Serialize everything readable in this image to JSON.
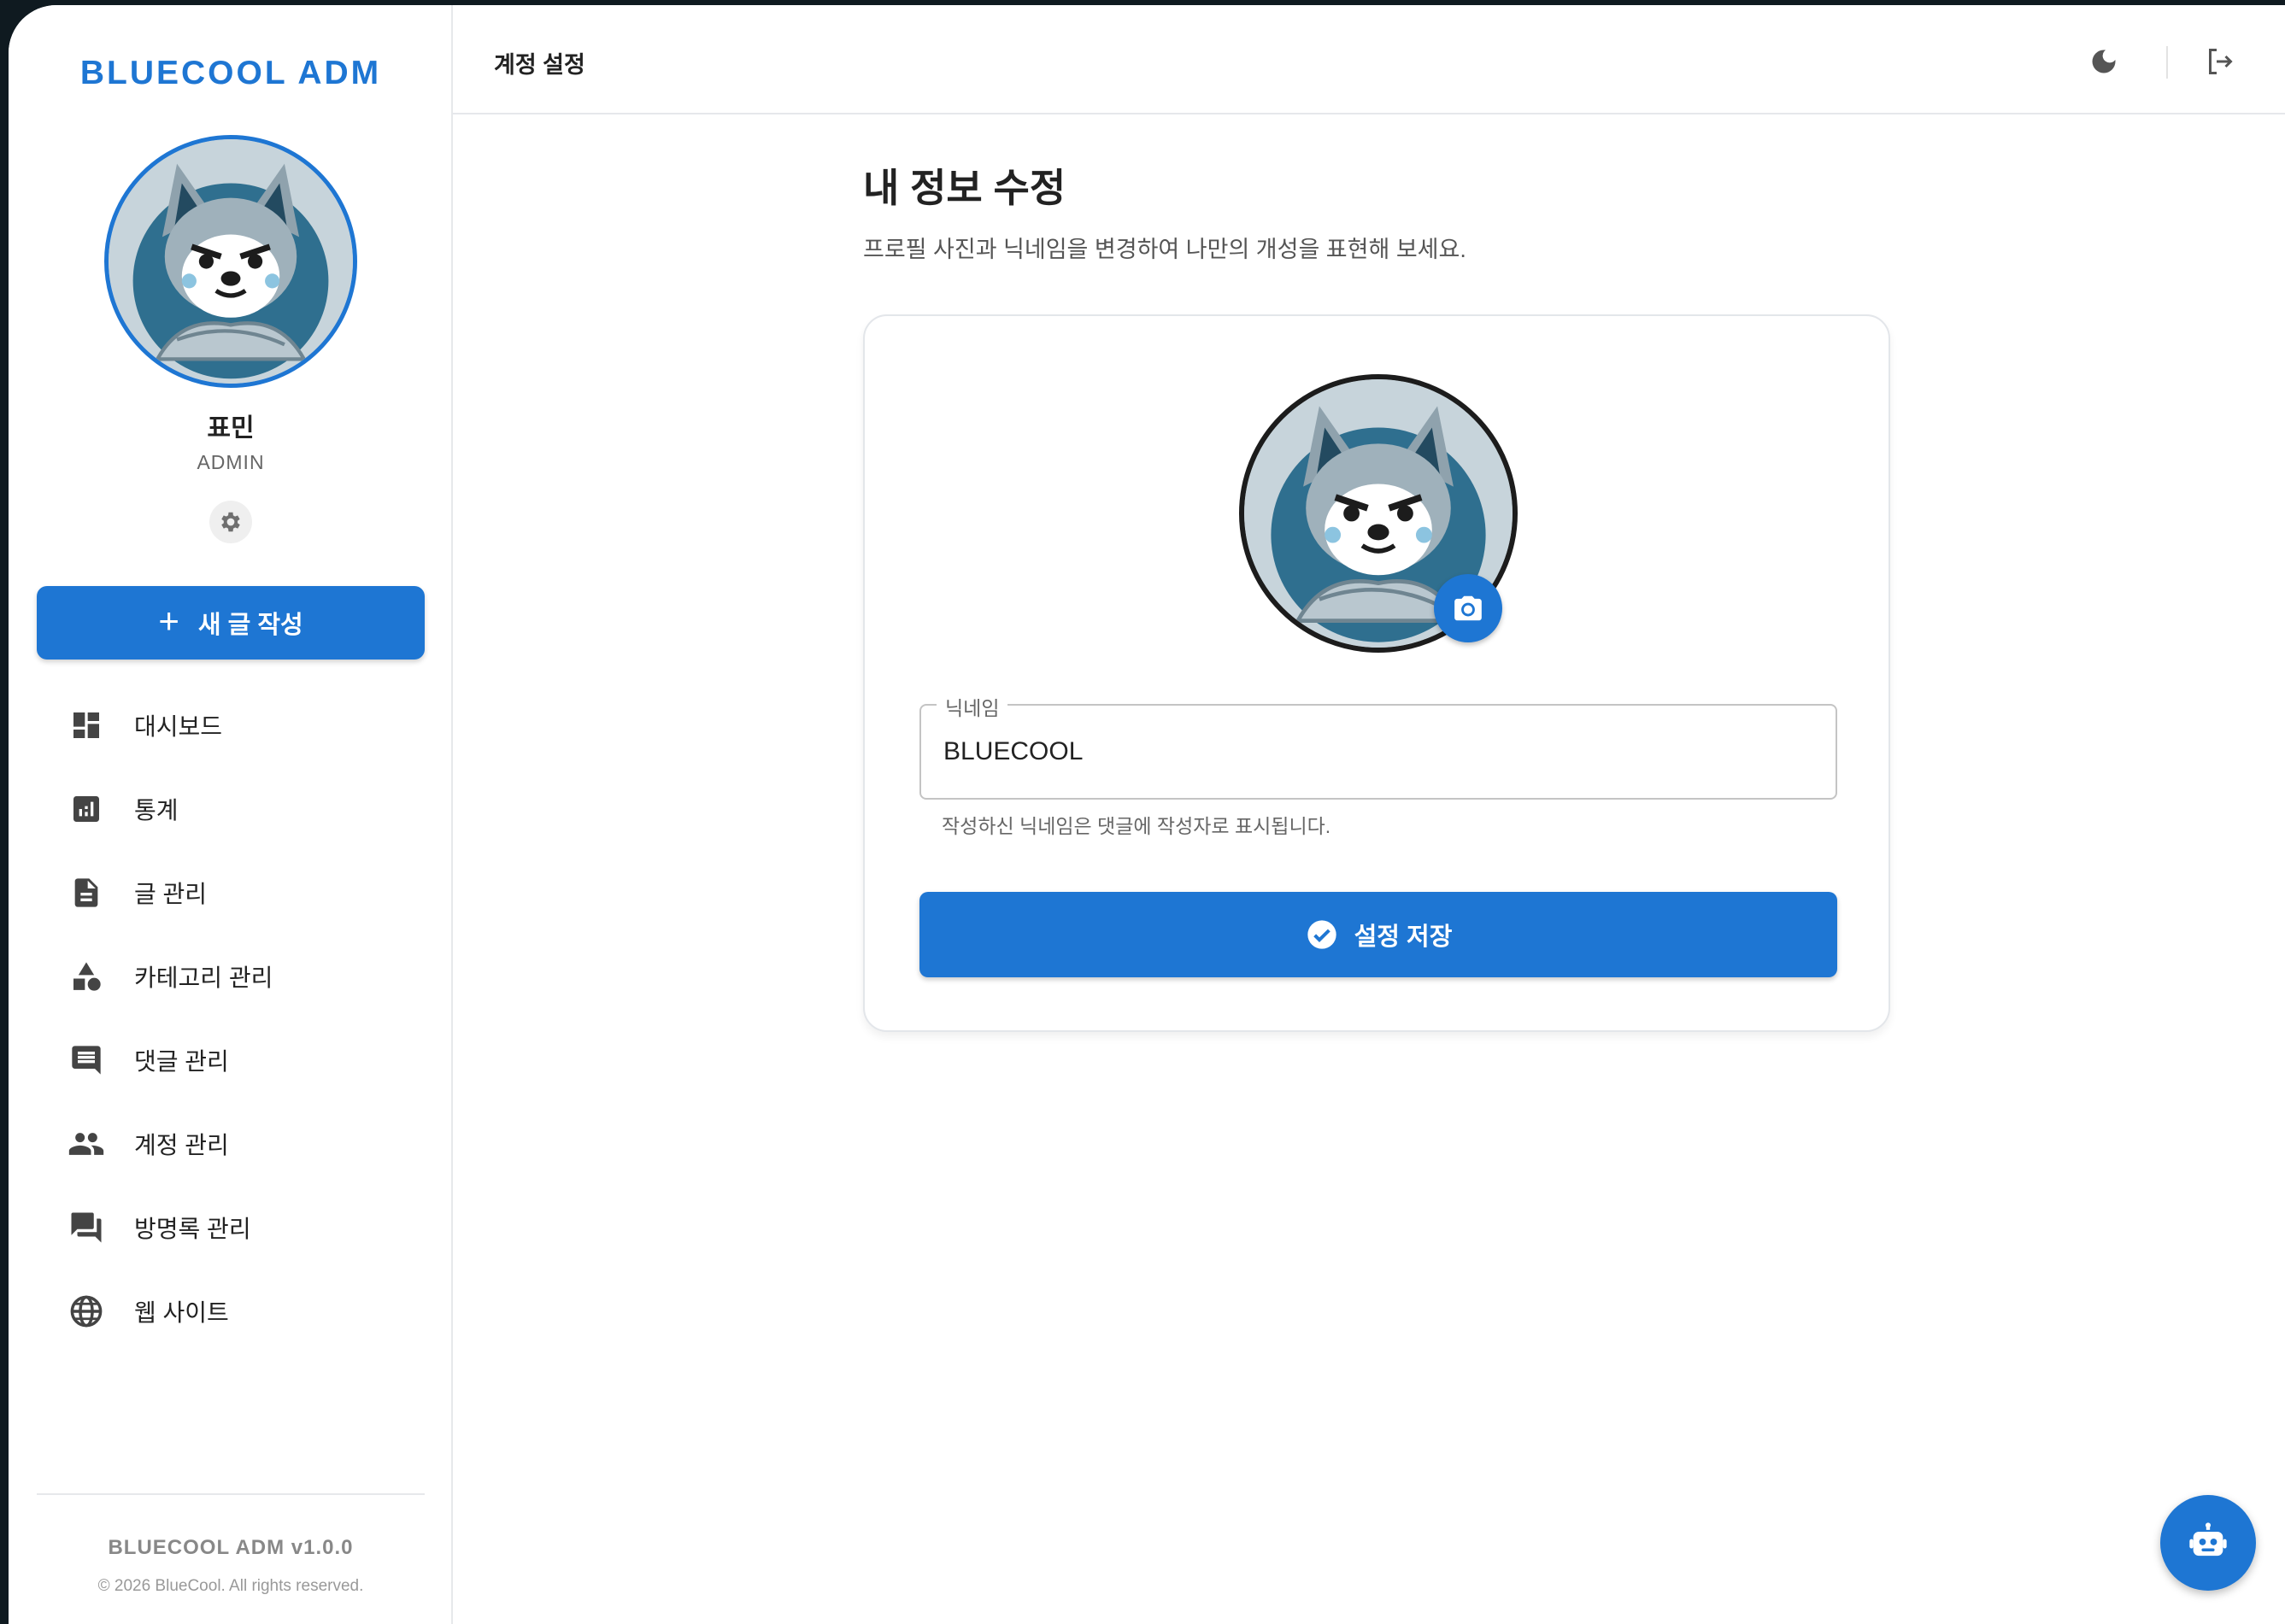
{
  "sidebar": {
    "brand": "BLUECOOL ADM",
    "user": {
      "name": "표민",
      "role": "ADMIN"
    },
    "new_post_label": "새 글 작성",
    "items": [
      {
        "label": "대시보드",
        "icon": "dashboard-icon"
      },
      {
        "label": "통계",
        "icon": "stats-icon"
      },
      {
        "label": "글 관리",
        "icon": "document-icon"
      },
      {
        "label": "카테고리 관리",
        "icon": "category-icon"
      },
      {
        "label": "댓글 관리",
        "icon": "comment-icon"
      },
      {
        "label": "계정 관리",
        "icon": "people-icon"
      },
      {
        "label": "방명록 관리",
        "icon": "forum-icon"
      },
      {
        "label": "웹 사이트",
        "icon": "globe-icon"
      }
    ],
    "version": "BLUECOOL ADM v1.0.0",
    "copyright": "© 2026 BlueCool. All rights reserved."
  },
  "header": {
    "title": "계정 설정"
  },
  "main": {
    "title": "내 정보 수정",
    "description": "프로필 사진과 닉네임을 변경하여 나만의 개성을 표현해 보세요.",
    "nickname": {
      "label": "닉네임",
      "value": "BLUECOOL",
      "helper": "작성하신 닉네임은 댓글에 작성자로 표시됩니다."
    },
    "save_label": "설정 저장"
  },
  "colors": {
    "accent": "#1e76d3",
    "border": "#e3e6ea"
  }
}
